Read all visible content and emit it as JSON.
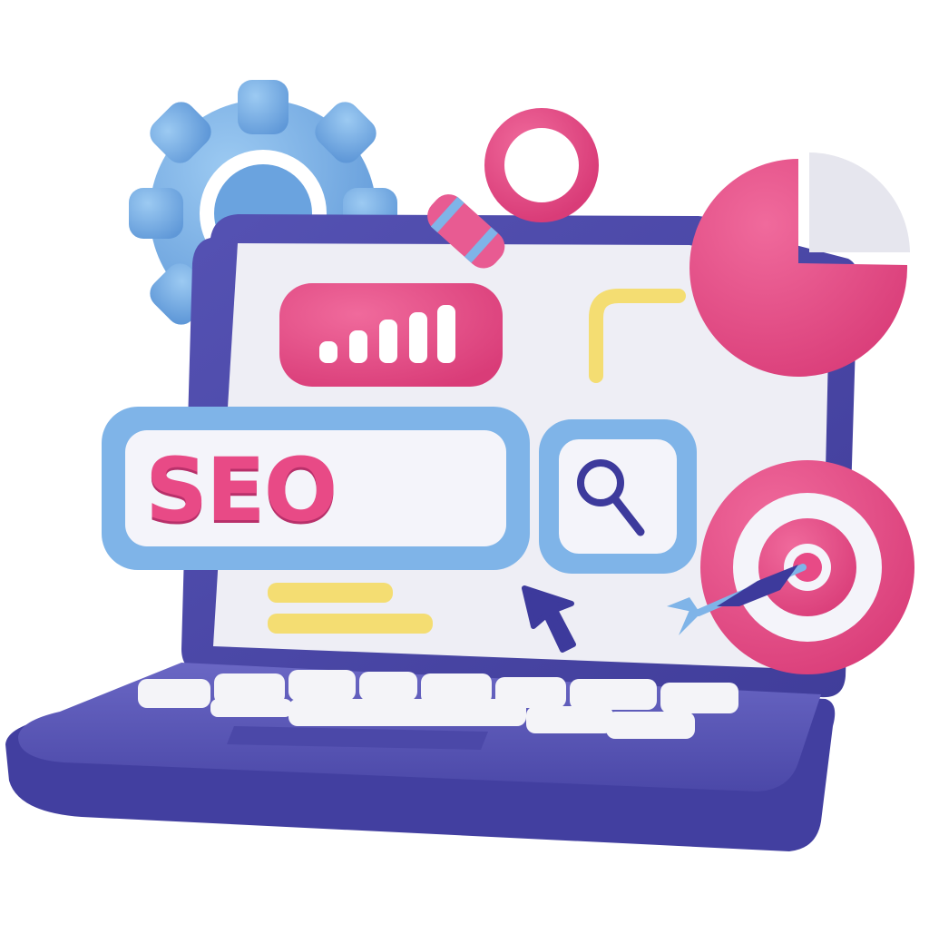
{
  "search_bar": {
    "text": "SEO"
  },
  "colors": {
    "laptop_body": "#4a47a6",
    "laptop_base": "#5b58b8",
    "screen": "#eeeef5",
    "pink": "#e84a86",
    "blue": "#7fb4e8",
    "yellow": "#f4dd72",
    "navy": "#3d3a9c",
    "key": "#f4f4f8",
    "white_slice": "#e6e6ee"
  },
  "icons": {
    "gear": "gear-icon",
    "magnifier_top": "magnifying-glass-icon",
    "magnifier_button": "search-icon",
    "bar_signal": "signal-bars-icon",
    "pie": "pie-chart-icon",
    "target": "target-icon",
    "dart": "dart-icon",
    "cursor": "cursor-arrow-icon"
  }
}
